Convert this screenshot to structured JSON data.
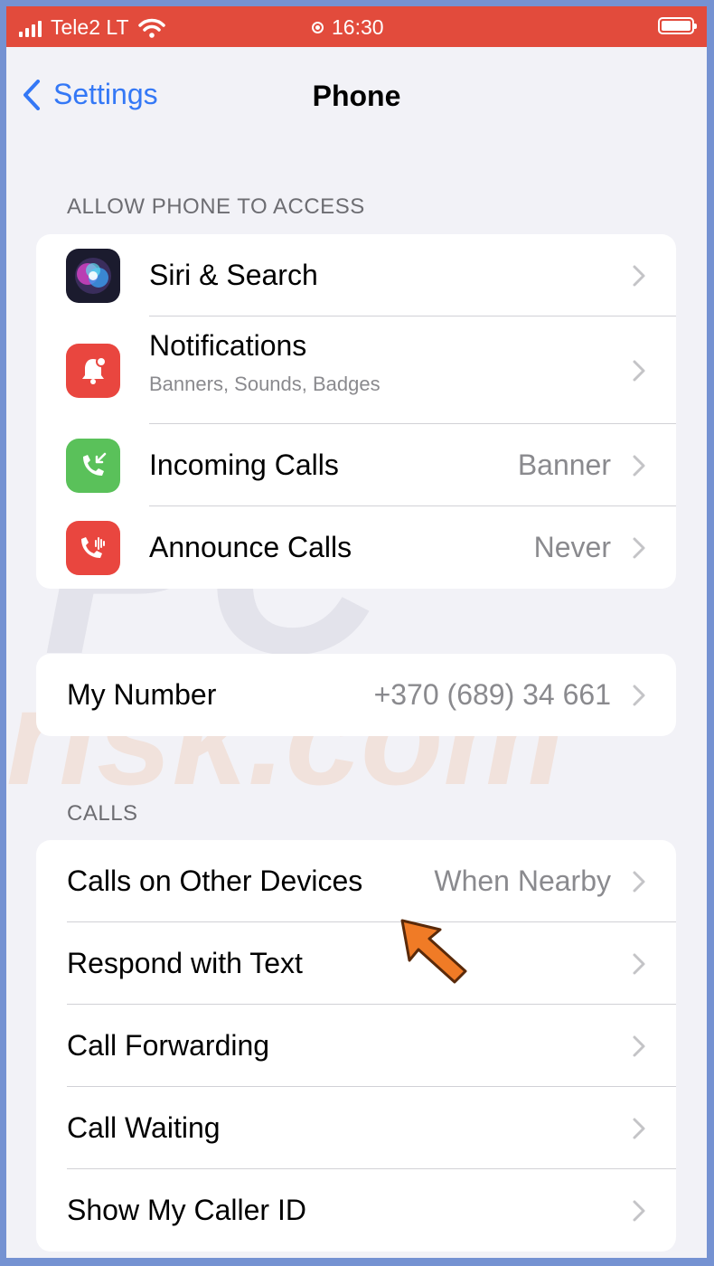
{
  "status_bar": {
    "carrier": "Tele2 LT",
    "time": "16:30",
    "icons": [
      "signal-icon",
      "wifi-icon",
      "location-icon",
      "battery-icon"
    ]
  },
  "nav": {
    "back_label": "Settings",
    "title": "Phone"
  },
  "sections": {
    "allow_access_header": "ALLOW PHONE TO ACCESS",
    "calls_header": "CALLS"
  },
  "access_items": [
    {
      "label": "Siri & Search",
      "icon": "siri-icon"
    },
    {
      "label": "Notifications",
      "subtitle": "Banners, Sounds, Badges",
      "icon": "notifications-icon",
      "icon_color": "#e9463f"
    },
    {
      "label": "Incoming Calls",
      "value": "Banner",
      "icon": "incoming-call-icon",
      "icon_color": "#5ac15a"
    },
    {
      "label": "Announce Calls",
      "value": "Never",
      "icon": "announce-calls-icon",
      "icon_color": "#e9463f"
    }
  ],
  "my_number": {
    "label": "My Number",
    "value": "+370 (689) 34 661"
  },
  "calls_items": [
    {
      "label": "Calls on Other Devices",
      "value": "When Nearby"
    },
    {
      "label": "Respond with Text"
    },
    {
      "label": "Call Forwarding"
    },
    {
      "label": "Call Waiting"
    },
    {
      "label": "Show My Caller ID"
    }
  ],
  "colors": {
    "status_bar": "#e24b3c",
    "accent": "#3478f6",
    "background": "#f2f2f7",
    "frame": "#7592d2",
    "arrow": "#f07b26"
  }
}
